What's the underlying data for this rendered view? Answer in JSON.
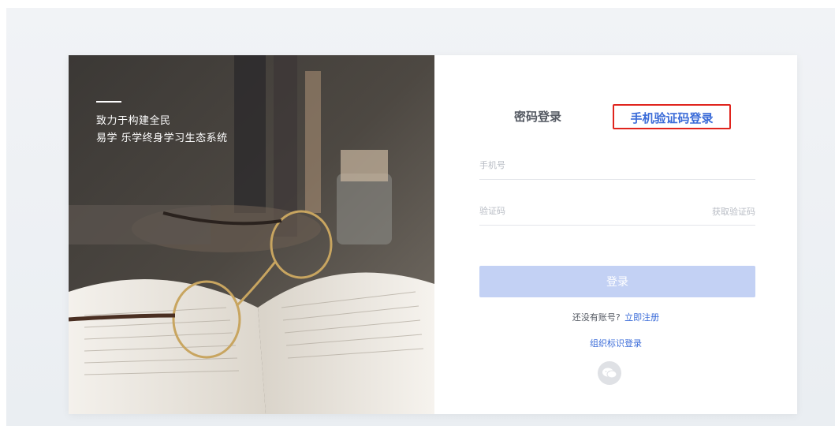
{
  "hero": {
    "slogan_line1": "致力于构建全民",
    "slogan_line2": "易学 乐学终身学习生态系统"
  },
  "tabs": {
    "password_login": "密码登录",
    "sms_login": "手机验证码登录",
    "active": "sms_login"
  },
  "form": {
    "phone_placeholder": "手机号",
    "code_placeholder": "验证码",
    "get_code_label": "获取验证码",
    "login_button": "登录"
  },
  "footer": {
    "no_account_text": "还没有账号?",
    "register_link": "立即注册",
    "org_login_link": "组织标识登录"
  },
  "icons": {
    "social": "wechat-icon"
  },
  "colors": {
    "accent": "#3a6bd8",
    "button_disabled": "#c3d1f4",
    "highlight_border": "#e0241d"
  }
}
